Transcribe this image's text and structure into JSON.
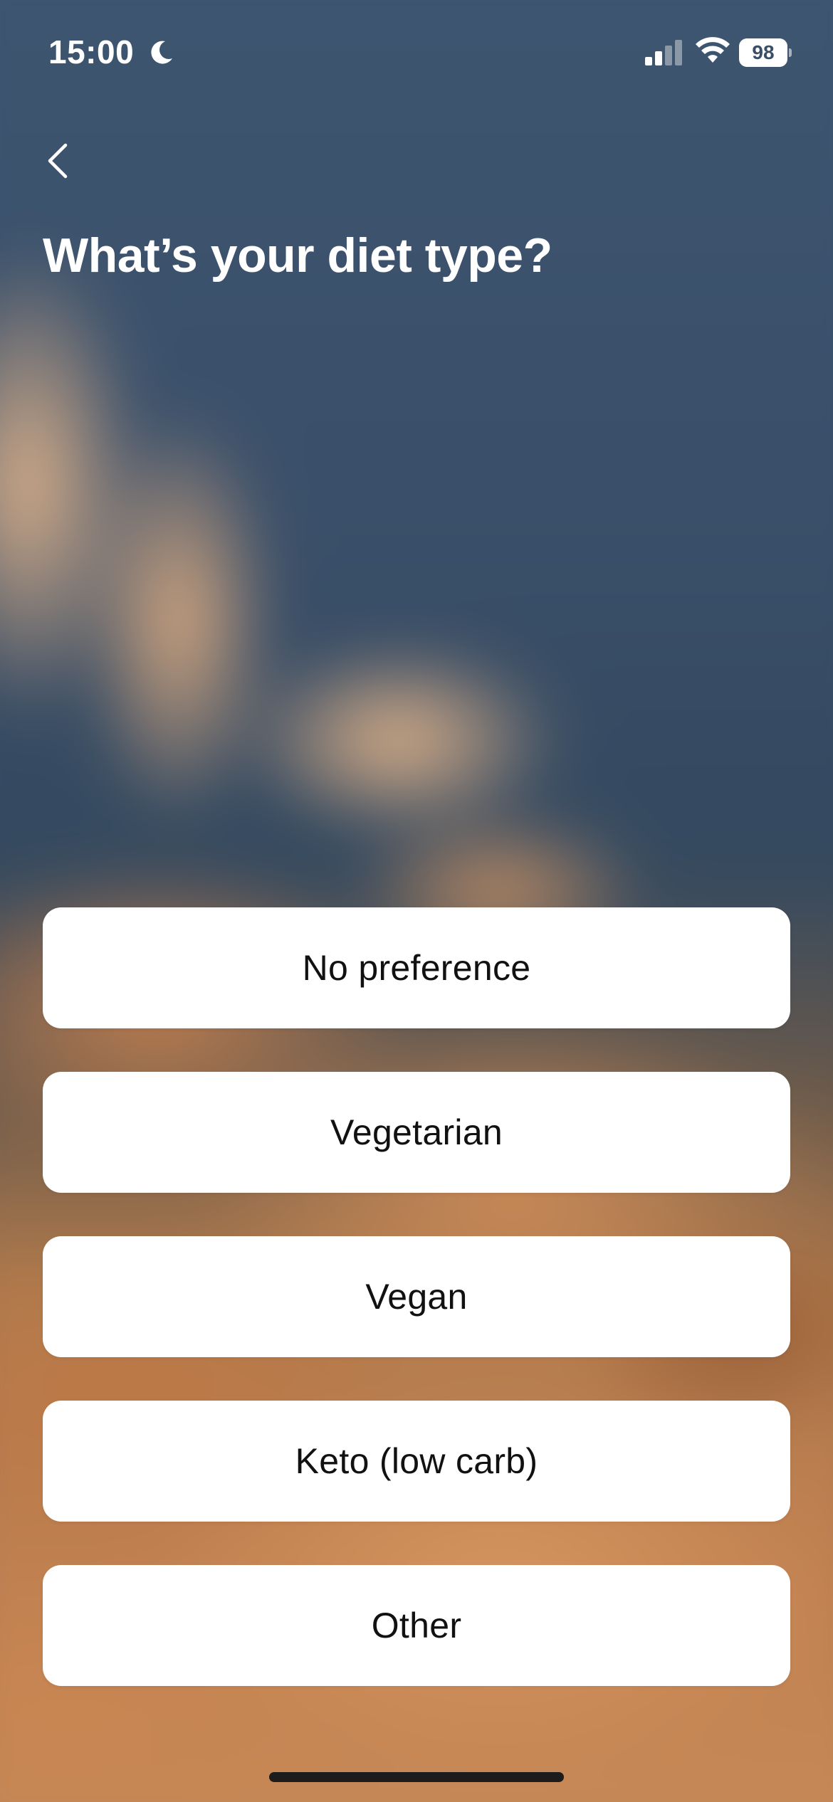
{
  "status_bar": {
    "time": "15:00",
    "battery": "98",
    "icons": [
      "moon-icon",
      "cellular-signal-icon",
      "wifi-icon",
      "battery-icon"
    ]
  },
  "header": {
    "back_icon": "chevron-left-icon",
    "title": "What’s your diet type?"
  },
  "options": [
    {
      "label": "No preference"
    },
    {
      "label": "Vegetarian"
    },
    {
      "label": "Vegan"
    },
    {
      "label": "Keto (low carb)"
    },
    {
      "label": "Other"
    }
  ],
  "colors": {
    "background_top": "#3a4e66",
    "background_bottom": "#c88a58",
    "option_background": "#ffffff",
    "option_text": "#111111",
    "title_text": "#ffffff"
  }
}
